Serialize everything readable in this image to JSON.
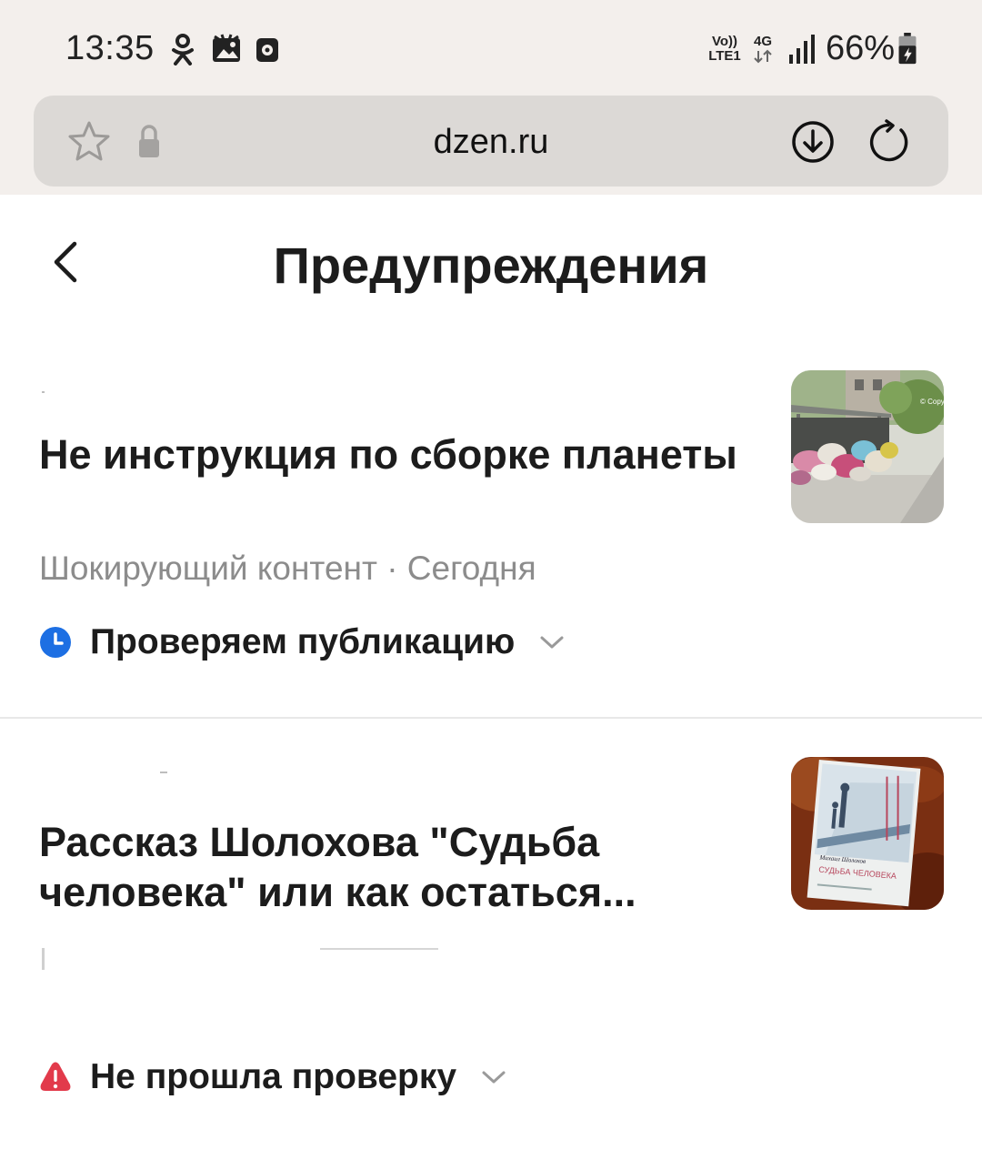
{
  "status_bar": {
    "time": "13:35",
    "icons_left": [
      "odnoklassniki-icon",
      "gallery-notification-icon",
      "recorder-icon"
    ],
    "net_volte": "Vo))",
    "net_lte": "LTE1",
    "net_4g": "4G",
    "battery": "66%",
    "battery_level": 0.66
  },
  "browser": {
    "url": "dzen.ru",
    "icons": [
      "star-icon",
      "lock-icon",
      "download-icon",
      "reload-icon"
    ]
  },
  "header": {
    "title": "Предупреждения"
  },
  "cards": [
    {
      "title": "Не инструкция по сборке планеты",
      "meta": "Шокирующий контент · Сегодня",
      "status": "Проверяем публикацию",
      "status_color": "#1d6fe3"
    },
    {
      "title": "Рассказ Шолохова \"Судьба человека\" или как остаться...",
      "status": "Не прошла проверку",
      "status_color": "#e23a4b"
    }
  ],
  "thumbnails": [
    {
      "watermark": "© Copy"
    },
    {
      "book_author": "Михаил Шолохов",
      "book_title": "СУДЬБА ЧЕЛОВЕКА"
    }
  ]
}
